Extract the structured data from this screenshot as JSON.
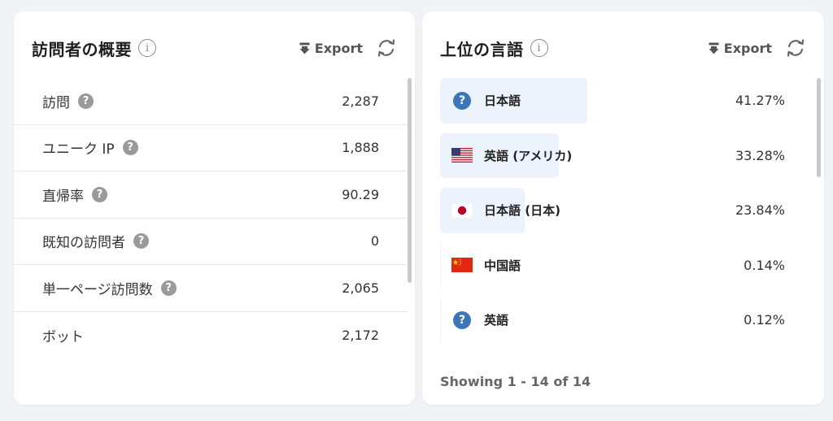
{
  "visitor_overview": {
    "title": "訪問者の概要",
    "export_label": "Export",
    "stats": [
      {
        "label": "訪問",
        "value": "2,287"
      },
      {
        "label": "ユニーク IP",
        "value": "1,888"
      },
      {
        "label": "直帰率",
        "value": "90.29"
      },
      {
        "label": "既知の訪問者",
        "value": "0"
      },
      {
        "label": "単一ページ訪問数",
        "value": "2,065"
      },
      {
        "label": "ボット",
        "value": "2,172",
        "no_help": true
      }
    ]
  },
  "top_languages": {
    "title": "上位の言語",
    "export_label": "Export",
    "languages": [
      {
        "name": "日本語",
        "percent": "41.27%",
        "share": 41.27,
        "icon": "question-icon"
      },
      {
        "name": "英語 (アメリカ)",
        "percent": "33.28%",
        "share": 33.28,
        "icon": "us-flag-icon"
      },
      {
        "name": "日本語 (日本)",
        "percent": "23.84%",
        "share": 23.84,
        "icon": "japan-flag-icon"
      },
      {
        "name": "中国語",
        "percent": "0.14%",
        "share": 0.14,
        "icon": "china-flag-icon"
      },
      {
        "name": "英語",
        "percent": "0.12%",
        "share": 0.12,
        "icon": "question-icon"
      }
    ],
    "footer": "Showing 1 - 14 of 14"
  },
  "colors": {
    "bar": "#edf3fd",
    "question_icon": "#3b76b8",
    "help_icon": "#9a9a9a"
  }
}
